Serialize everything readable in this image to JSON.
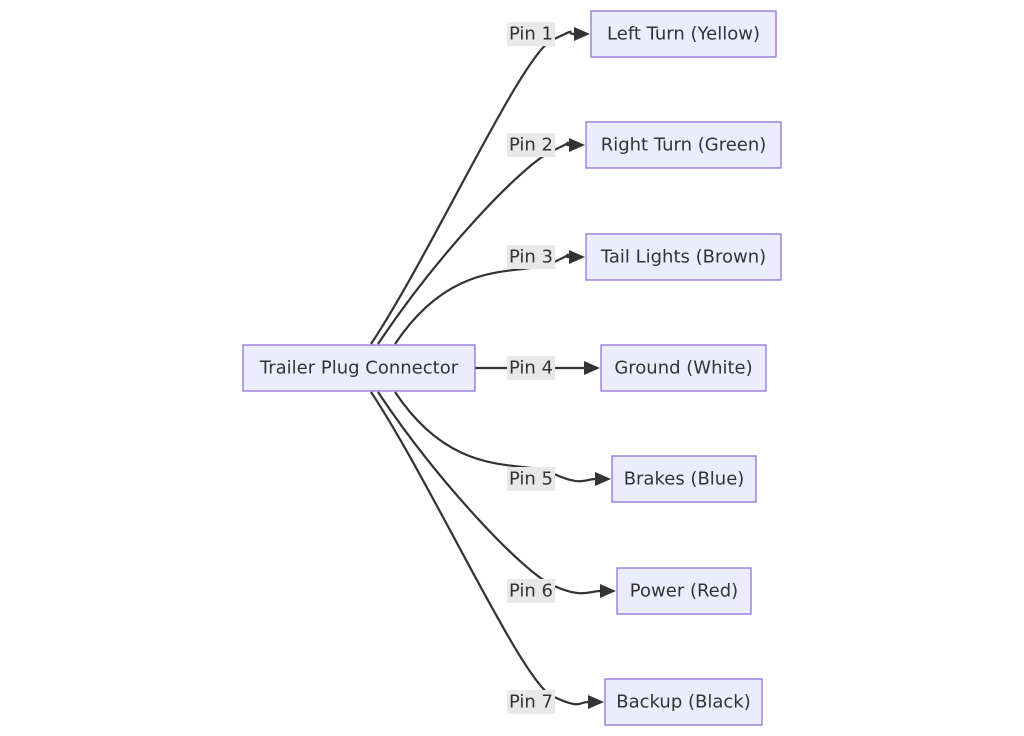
{
  "diagram": {
    "type": "flowchart",
    "direction": "LR",
    "colors": {
      "node_fill": "#ECECFF",
      "node_stroke": "#9370DB",
      "edge": "#333333",
      "label_bg": "#E8E8E8",
      "text": "#333333"
    },
    "source": {
      "id": "plug",
      "label": "Trailer Plug Connector"
    },
    "targets": [
      {
        "id": "pin1",
        "label": "Left Turn (Yellow)",
        "edge_label": "Pin 1"
      },
      {
        "id": "pin2",
        "label": "Right Turn (Green)",
        "edge_label": "Pin 2"
      },
      {
        "id": "pin3",
        "label": "Tail Lights (Brown)",
        "edge_label": "Pin 3"
      },
      {
        "id": "pin4",
        "label": "Ground (White)",
        "edge_label": "Pin 4"
      },
      {
        "id": "pin5",
        "label": "Brakes (Blue)",
        "edge_label": "Pin 5"
      },
      {
        "id": "pin6",
        "label": "Power (Red)",
        "edge_label": "Pin 6"
      },
      {
        "id": "pin7",
        "label": "Backup (Black)",
        "edge_label": "Pin 7"
      }
    ]
  }
}
